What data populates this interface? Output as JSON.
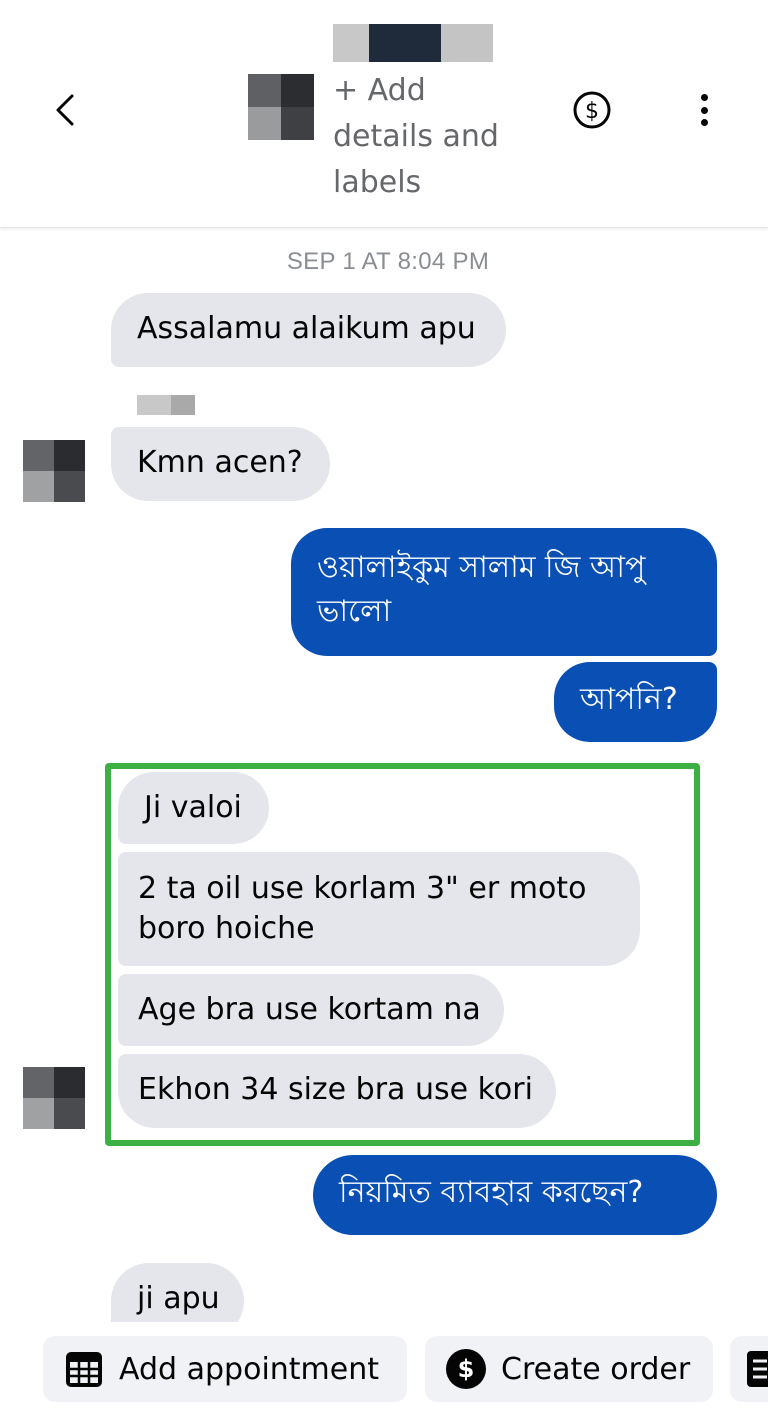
{
  "header": {
    "back_icon": "chevron-left-icon",
    "add_details_label": "+ Add details and labels",
    "payment_icon": "dollar-circle-icon",
    "more_icon": "vertical-dots-icon"
  },
  "chat": {
    "timestamp": "SEP 1 AT 8:04 PM",
    "messages": [
      {
        "side": "incoming",
        "text": "Assalamu alaikum apu"
      },
      {
        "side": "incoming",
        "text": "Kmn acen?"
      },
      {
        "side": "outgoing",
        "text": "ওয়ালাইকুম সালাম জি আপু ভালো"
      },
      {
        "side": "outgoing",
        "text": "আপনি?"
      },
      {
        "side": "incoming",
        "text": "Ji valoi"
      },
      {
        "side": "incoming",
        "text": "2 ta oil use korlam 3\" er moto boro hoiche"
      },
      {
        "side": "incoming",
        "text": "Age bra use kortam na"
      },
      {
        "side": "incoming",
        "text": "Ekhon 34 size bra use kori"
      },
      {
        "side": "outgoing",
        "text": "নিয়মিত ব্যাবহার করছেন?"
      },
      {
        "side": "incoming",
        "text": "ji apu"
      }
    ]
  },
  "actions": [
    {
      "label": "Add appointment",
      "icon": "calendar-icon"
    },
    {
      "label": "Create order",
      "icon": "dollar-circle-icon"
    }
  ],
  "colors": {
    "outgoing_bubble": "#0a4fb3",
    "incoming_bubble": "#e4e6eb",
    "highlight_border": "#3cb043",
    "muted_text": "#65676b"
  }
}
